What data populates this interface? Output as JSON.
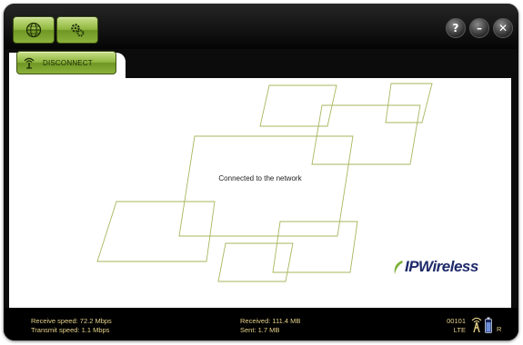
{
  "toolbar": {
    "disconnect_label": "DISCONNECT"
  },
  "window_controls": {
    "help_label": "?",
    "minimize_label": "–",
    "close_label": "✕"
  },
  "main": {
    "status_message": "Connected to the network",
    "logo_text": "IPWireless"
  },
  "status": {
    "receive_speed": "Receive speed: 72.2 Mbps",
    "transmit_speed": "Transmit speed: 1.1 Mbps",
    "received": "Received: 111.4 MB",
    "sent": "Sent: 1.7 MB",
    "network_code": "00101",
    "network_type": "LTE",
    "roaming_indicator": "R",
    "signal_strength_fraction": 1.0,
    "battery_fraction": 0.8
  },
  "icons": {
    "globe": "globe-icon",
    "settings": "gear-icon",
    "disconnect": "antenna-icon",
    "antenna": "antenna-icon",
    "battery": "battery-icon"
  },
  "colors": {
    "accent_green": "#8fb73e",
    "status_text": "#e5d18a",
    "line_art": "#a9b65e",
    "logo_blue": "#1e2a6a",
    "logo_green": "#7fb03a"
  }
}
